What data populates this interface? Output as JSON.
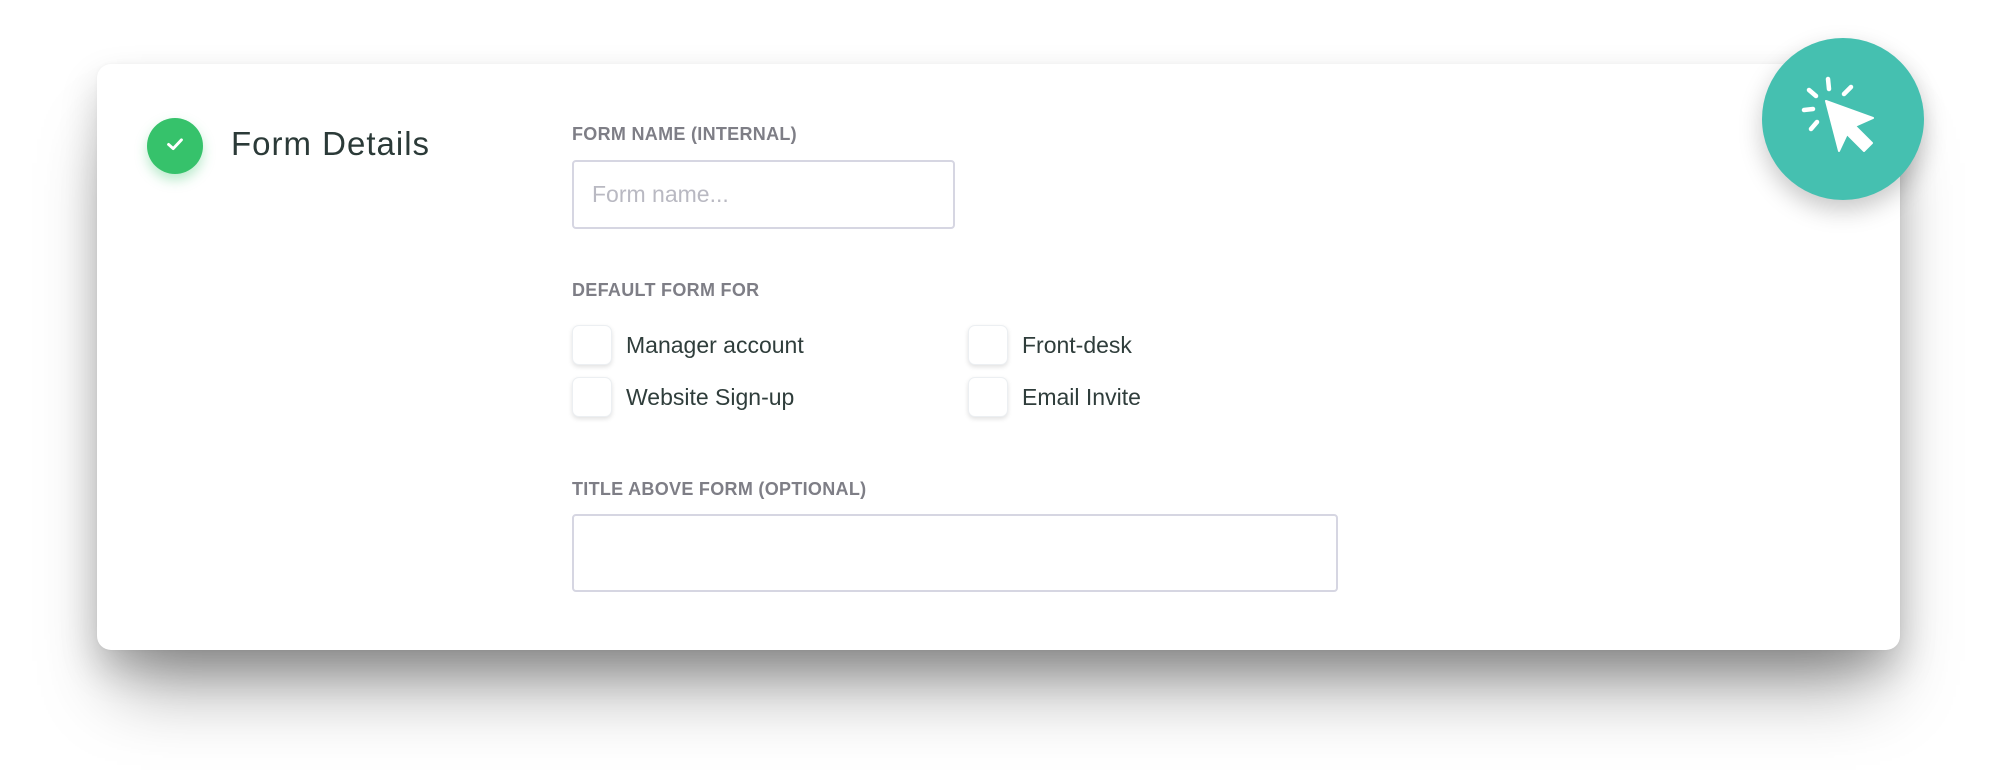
{
  "section": {
    "title": "Form Details"
  },
  "form_name": {
    "label": "FORM NAME (INTERNAL)",
    "placeholder": "Form name...",
    "value": ""
  },
  "default_form_for": {
    "label": "DEFAULT FORM FOR",
    "options": [
      {
        "label": "Manager account",
        "checked": false
      },
      {
        "label": "Front-desk",
        "checked": false
      },
      {
        "label": "Website Sign-up",
        "checked": false
      },
      {
        "label": "Email Invite",
        "checked": false
      }
    ]
  },
  "title_above_form": {
    "label": "TITLE ABOVE FORM (OPTIONAL)",
    "value": ""
  },
  "icons": {
    "section_status": "check-icon",
    "fab": "cursor-click-icon"
  },
  "colors": {
    "success": "#36c26b",
    "accent": "#45c0b0",
    "label": "#7e7e86",
    "text": "#2f3d3b",
    "input_border": "#d6d6e2"
  }
}
